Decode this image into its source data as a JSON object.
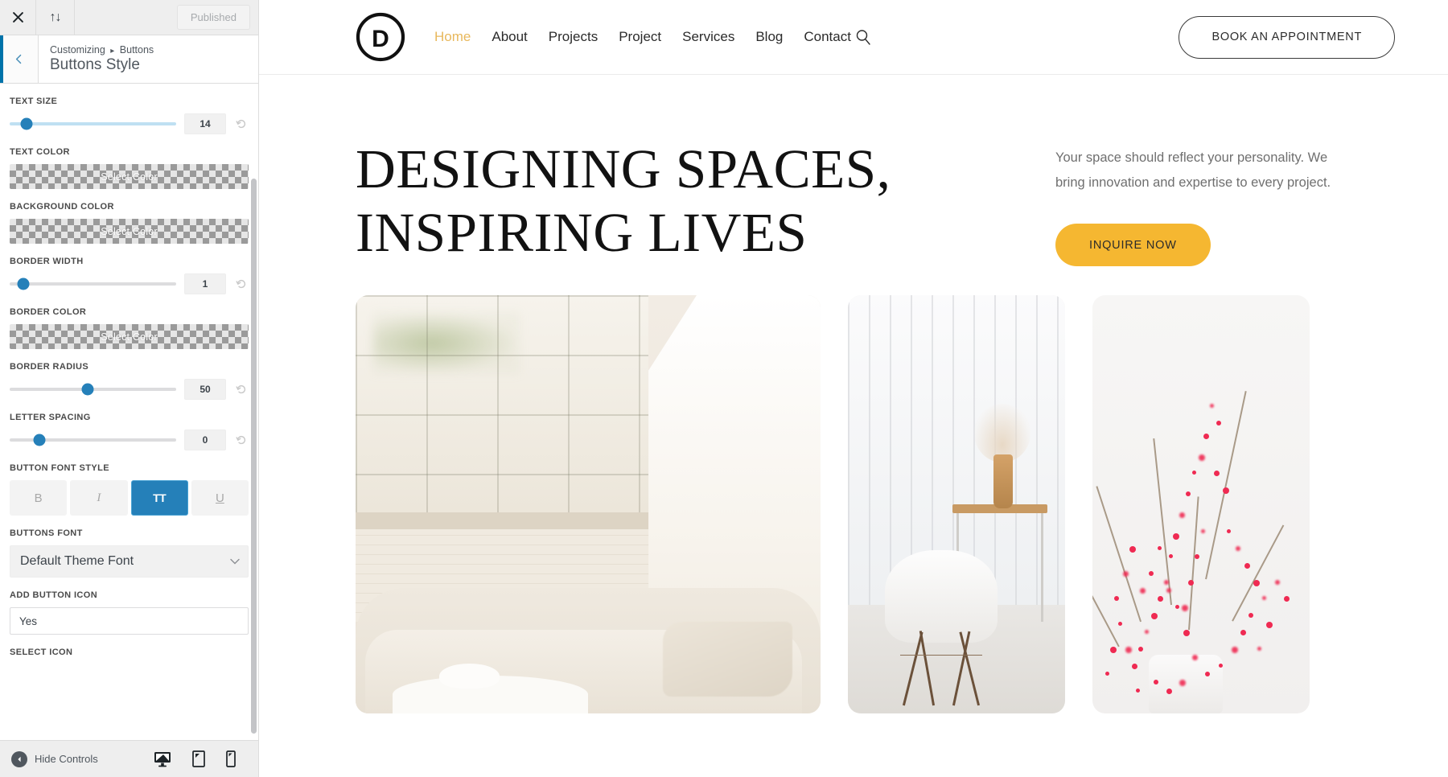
{
  "customizer": {
    "topbar": {
      "close_icon": "close-icon",
      "devices_icon": "sort-arrows-icon",
      "publish_label": "Published"
    },
    "header": {
      "back_icon": "chevron-left-icon",
      "breadcrumb_root": "Customizing",
      "breadcrumb_separator": "▸",
      "breadcrumb_current": "Buttons",
      "panel_title": "Buttons Style"
    },
    "controls": [
      {
        "type": "slider",
        "label": "TEXT SIZE",
        "value": "14",
        "handle_pct": 10,
        "track": "blue",
        "reset_icon": "reset-icon"
      },
      {
        "type": "color",
        "label": "TEXT COLOR",
        "value": "Select Color"
      },
      {
        "type": "color",
        "label": "BACKGROUND COLOR",
        "value": "Select Color"
      },
      {
        "type": "slider",
        "label": "BORDER WIDTH",
        "value": "1",
        "handle_pct": 8,
        "track": "gray",
        "reset_icon": "reset-icon"
      },
      {
        "type": "color",
        "label": "BORDER COLOR",
        "value": "Select Color"
      },
      {
        "type": "slider",
        "label": "BORDER RADIUS",
        "value": "50",
        "handle_pct": 47,
        "track": "gray",
        "reset_icon": "reset-icon"
      },
      {
        "type": "slider",
        "label": "LETTER SPACING",
        "value": "0",
        "handle_pct": 18,
        "track": "gray",
        "reset_icon": "reset-icon"
      }
    ],
    "font_style": {
      "label": "BUTTON FONT STYLE",
      "buttons": [
        {
          "glyph": "B",
          "name": "bold-button",
          "active": false
        },
        {
          "glyph": "I",
          "name": "italic-button",
          "active": false
        },
        {
          "glyph": "TT",
          "name": "uppercase-button",
          "active": true
        },
        {
          "glyph": "U",
          "name": "underline-button",
          "active": false
        }
      ]
    },
    "buttons_font": {
      "label": "BUTTONS FONT",
      "value": "Default Theme Font",
      "chevron_icon": "chevron-down-icon"
    },
    "add_button_icon": {
      "label": "ADD BUTTON ICON",
      "value": "Yes"
    },
    "select_icon": {
      "label": "SELECT ICON"
    },
    "footer": {
      "hide_controls_label": "Hide Controls",
      "hide_icon": "caret-left-circle-icon",
      "devices": [
        {
          "name": "desktop-preview-button",
          "icon": "desktop-icon",
          "active": true
        },
        {
          "name": "tablet-preview-button",
          "icon": "tablet-icon",
          "active": false
        },
        {
          "name": "mobile-preview-button",
          "icon": "mobile-icon",
          "active": false
        }
      ]
    }
  },
  "site": {
    "logo": {
      "letter": "D",
      "name": "divi-logo"
    },
    "nav": [
      {
        "label": "Home",
        "active": true
      },
      {
        "label": "About",
        "active": false
      },
      {
        "label": "Projects",
        "active": false
      },
      {
        "label": "Project",
        "active": false
      },
      {
        "label": "Services",
        "active": false
      },
      {
        "label": "Blog",
        "active": false
      },
      {
        "label": "Contact",
        "active": false
      }
    ],
    "search_icon": "search-icon",
    "appointment_button": "BOOK AN APPOINTMENT",
    "hero": {
      "title_line1": "DESIGNING SPACES,",
      "title_line2": "INSPIRING LIVES",
      "paragraph": "Your space should reflect your personality. We bring innovation and expertise to every project.",
      "cta_label": "INQUIRE NOW"
    },
    "gallery": [
      {
        "name": "gallery-image-living-room"
      },
      {
        "name": "gallery-image-chair-vase"
      },
      {
        "name": "gallery-image-red-branches"
      }
    ]
  },
  "colors": {
    "accent_gold": "#e8b85c",
    "cta_amber": "#f5b731",
    "customizer_blue": "#2580b9",
    "panel_bar_blue": "#0073aa"
  }
}
